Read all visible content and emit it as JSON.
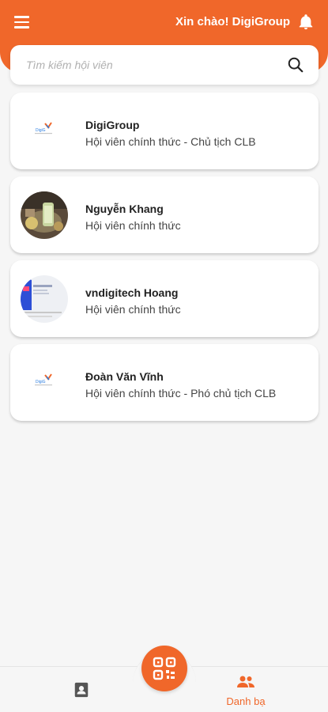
{
  "header": {
    "greeting": "Xin chào! DigiGroup"
  },
  "search": {
    "placeholder": "Tìm kiếm hội viên"
  },
  "members": [
    {
      "name": "DigiGroup",
      "role": "Hội viên chính thức - Chủ tịch CLB",
      "avatar": "digigroup-logo"
    },
    {
      "name": "Nguyễn Khang",
      "role": "Hội viên chính thức",
      "avatar": "photo"
    },
    {
      "name": "vndigitech Hoang",
      "role": "Hội viên chính thức",
      "avatar": "screenshot-thumbnail"
    },
    {
      "name": "Đoàn Văn Vĩnh",
      "role": "Hội viên chính thức - Phó chủ tịch CLB",
      "avatar": "digigroup-logo"
    }
  ],
  "bottom_nav": {
    "contacts_label": "Danh bạ"
  },
  "colors": {
    "accent": "#f0672a",
    "background": "#f6f6f6"
  },
  "icons": [
    "menu-icon",
    "bell-icon",
    "search-icon",
    "qr-code-icon",
    "profile-icon",
    "group-icon"
  ]
}
